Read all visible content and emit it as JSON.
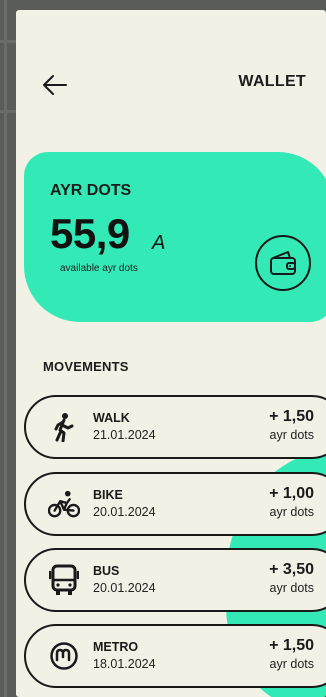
{
  "header": {
    "title": "WALLET",
    "back_icon": "arrow-left-icon"
  },
  "balance_card": {
    "label": "AYR DOTS",
    "amount": "55,9",
    "unit_symbol": "A",
    "subtitle": "available ayr dots",
    "wallet_icon": "wallet-icon",
    "color": "#33eab6"
  },
  "movements": {
    "title": "MOVEMENTS",
    "items": [
      {
        "name": "WALK",
        "date": "21.01.2024",
        "amount": "+ 1,50",
        "unit": "ayr dots",
        "icon": "walk-icon"
      },
      {
        "name": "BIKE",
        "date": "20.01.2024",
        "amount": "+ 1,00",
        "unit": "ayr dots",
        "icon": "bike-icon"
      },
      {
        "name": "BUS",
        "date": "20.01.2024",
        "amount": "+ 3,50",
        "unit": "ayr dots",
        "icon": "bus-icon"
      },
      {
        "name": "METRO",
        "date": "18.01.2024",
        "amount": "+ 1,50",
        "unit": "ayr dots",
        "icon": "metro-icon"
      }
    ]
  }
}
